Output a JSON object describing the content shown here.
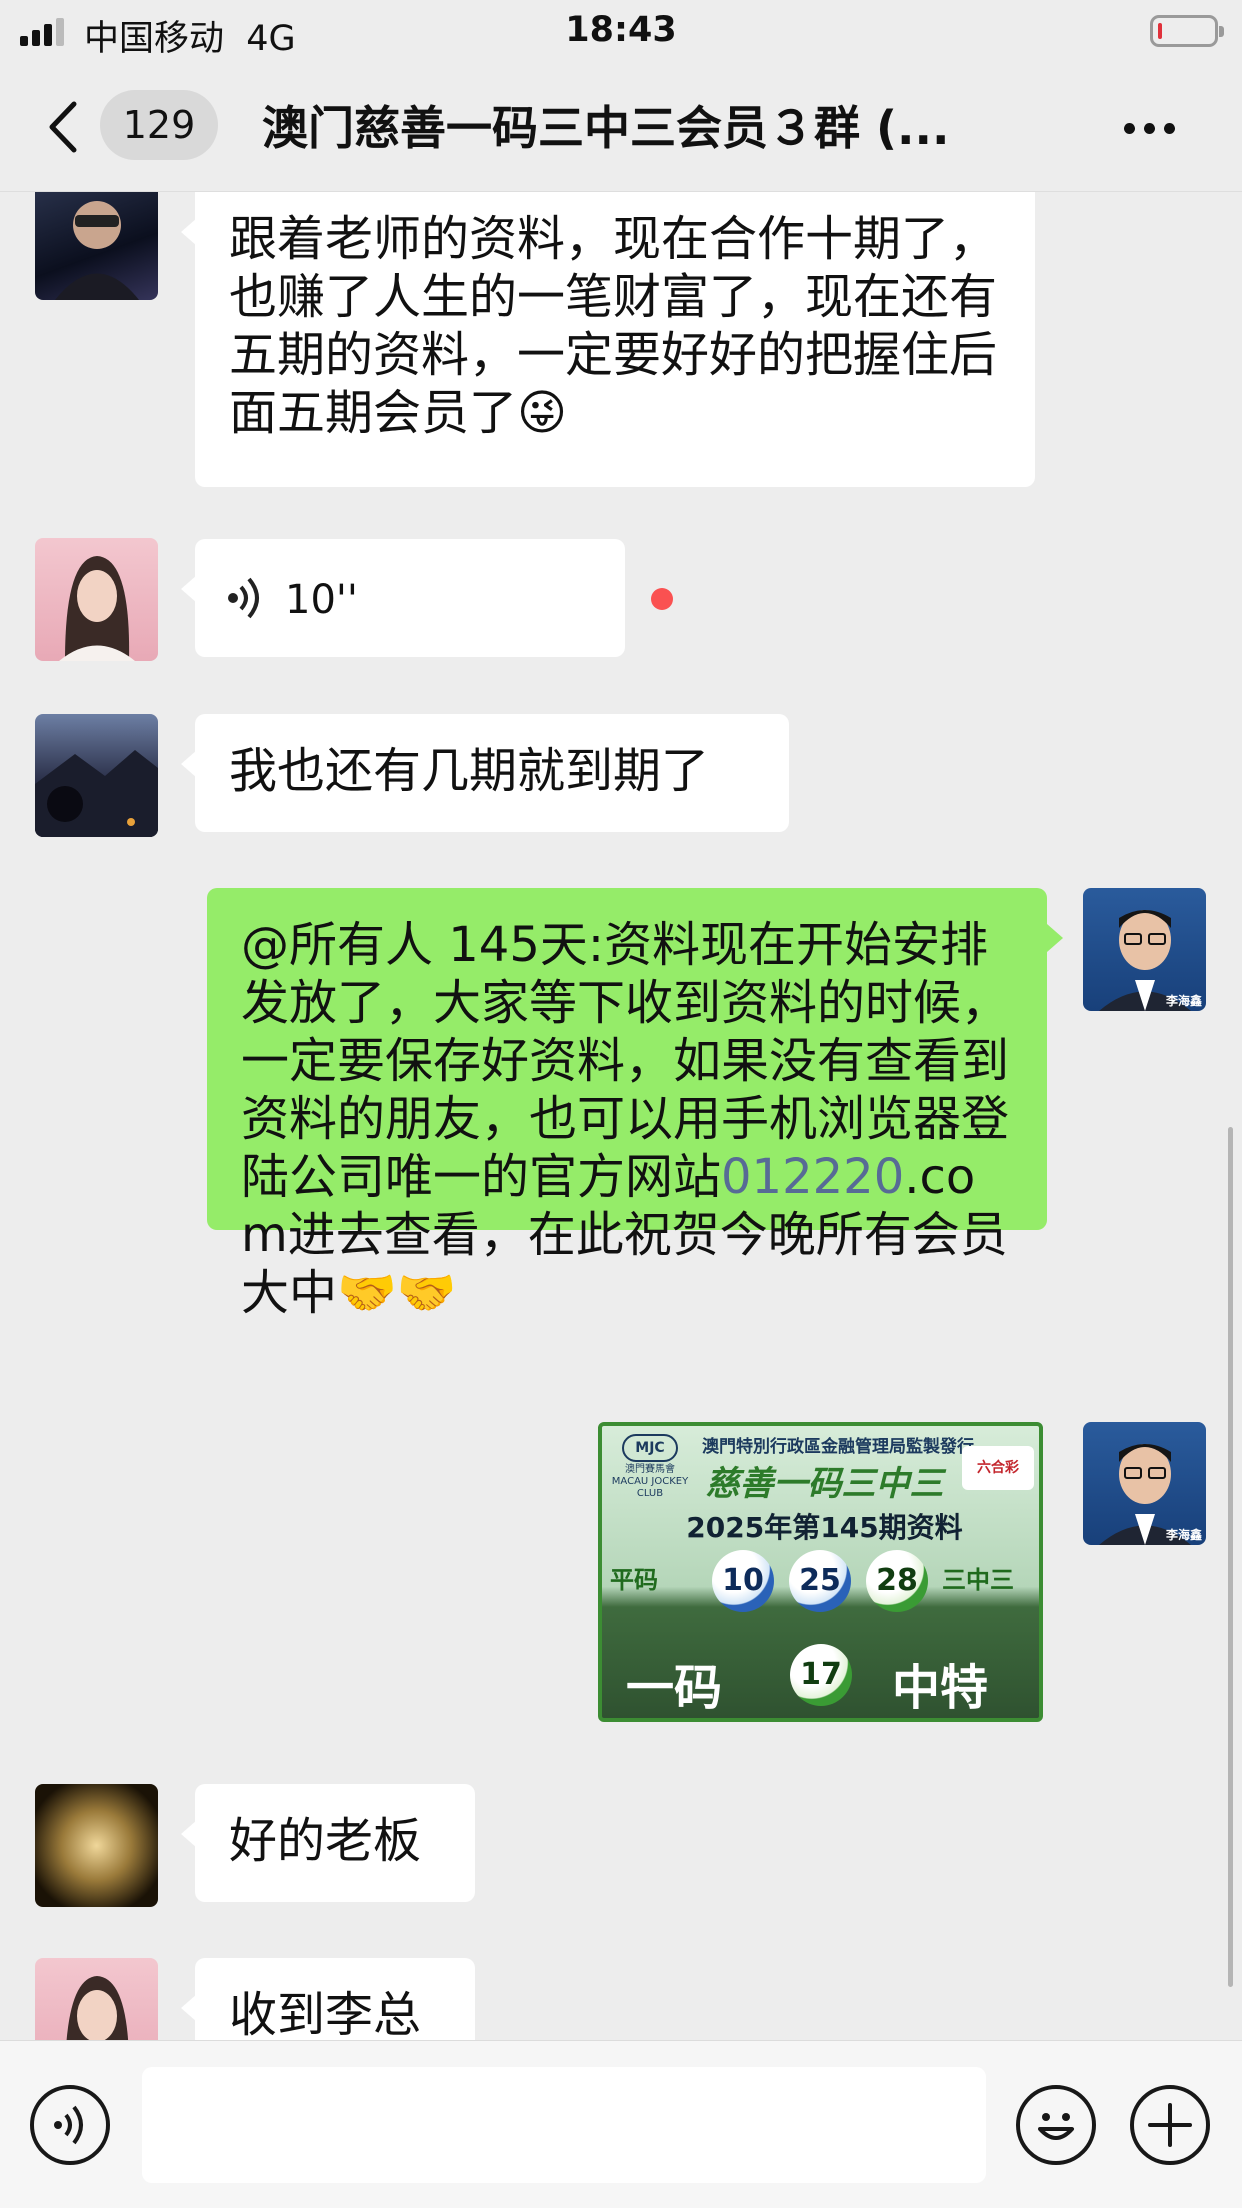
{
  "status": {
    "carrier": "中国移动",
    "network": "4G",
    "time": "18:43"
  },
  "nav": {
    "unread_count": "129",
    "title": "澳门慈善一码三中三会员３群 (..."
  },
  "messages": [
    {
      "text": "跟着老师的资料，现在合作十期了，也赚了人生的一笔财富了，现在还有五期的资料，一定要好好的把握住后面五期会员了",
      "emoji": "😜"
    },
    {
      "voice_duration": "10''"
    },
    {
      "text": "我也还有几期就到期了"
    },
    {
      "text_a": "@所有人 145天:资料现在开始安排发放了，大家等下收到资料的时候，一定要保存好资料，如果没有查看到资料的朋友，也可以用手机浏览器登陆公司唯一的官方网站",
      "link": "012220",
      "text_b": ".com进去查看，在此祝贺今晚所有会员大中",
      "emoji": "🤝🤝",
      "sender_name": "李海鑫"
    },
    {
      "image": {
        "issuer": "澳門特別行政區金融管理局監製發行",
        "club_cn": "澳門賽馬會",
        "club_en": "MACAU JOCKEY CLUB",
        "brand": "六合彩",
        "headline": "慈善一码三中三",
        "issue": "2025年第145期资料",
        "label_left": "平码",
        "label_right": "三中三",
        "balls": [
          "10",
          "25",
          "28"
        ],
        "special_left": "一码",
        "special_ball": "17",
        "special_right": "中特"
      },
      "sender_name": "李海鑫"
    },
    {
      "text": "好的老板"
    },
    {
      "text": "收到李总"
    }
  ]
}
